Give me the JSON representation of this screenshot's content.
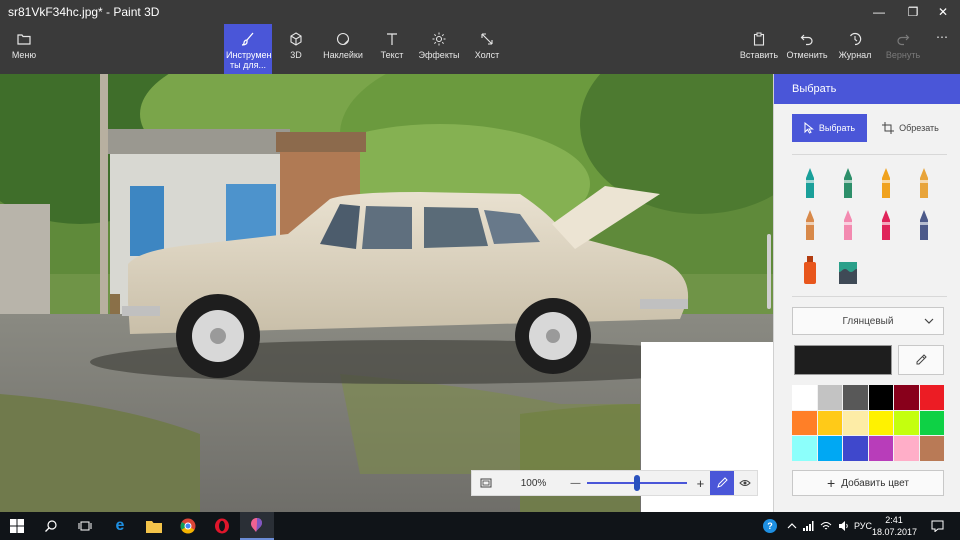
{
  "window": {
    "title": "sr81VkF34hc.jpg* - Paint 3D",
    "controls": {
      "minimize": "—",
      "maximize": "❐",
      "close": "✕"
    }
  },
  "ribbon": {
    "menu": "Меню",
    "tools": "Инструмен ты для...",
    "threed": "3D",
    "stickers": "Наклейки",
    "text": "Текст",
    "effects": "Эффекты",
    "canvas": "Холст",
    "paste": "Вставить",
    "undo": "Отменить",
    "history": "Журнал",
    "redo": "Вернуть",
    "more": "⋯"
  },
  "panel": {
    "header": "Выбрать",
    "select_button": "Выбрать",
    "crop_button": "Обрезать",
    "finish_dropdown": "Глянцевый",
    "current_color": "#1e1e1e",
    "add_color": "Добавить цвет",
    "palette": [
      "#ffffff",
      "#c3c3c3",
      "#585858",
      "#000000",
      "#88001b",
      "#ec1c24",
      "#ff7f27",
      "#ffca18",
      "#fdeca6",
      "#fff200",
      "#c4ff0e",
      "#0ed145",
      "#8cfffb",
      "#00a8f3",
      "#3f48cc",
      "#b83dba",
      "#ffaec8",
      "#b97a56"
    ],
    "tools": [
      {
        "name": "marker-icon",
        "color": "#1aa09a"
      },
      {
        "name": "calligraphy-pen-icon",
        "color": "#2d8f6a"
      },
      {
        "name": "oil-brush-icon",
        "color": "#f0a21e"
      },
      {
        "name": "watercolor-brush-icon",
        "color": "#e8a43a"
      },
      {
        "name": "pixel-pen-icon",
        "color": "#d8894a"
      },
      {
        "name": "pencil-icon",
        "color": "#f38ab0"
      },
      {
        "name": "eraser-icon",
        "color": "#e0245a"
      },
      {
        "name": "crayon-icon",
        "color": "#4d5a8a"
      },
      {
        "name": "spray-can-icon",
        "color": "#e8561c"
      },
      {
        "name": "fill-bucket-icon",
        "color": "#2ba08a"
      }
    ]
  },
  "zoom": {
    "level_text": "100%",
    "slider_position": 0.5,
    "minus": "—",
    "plus": "+"
  },
  "taskbar": {
    "language": "РУС",
    "time": "2:41",
    "date": "18.07.2017",
    "help": "?"
  }
}
